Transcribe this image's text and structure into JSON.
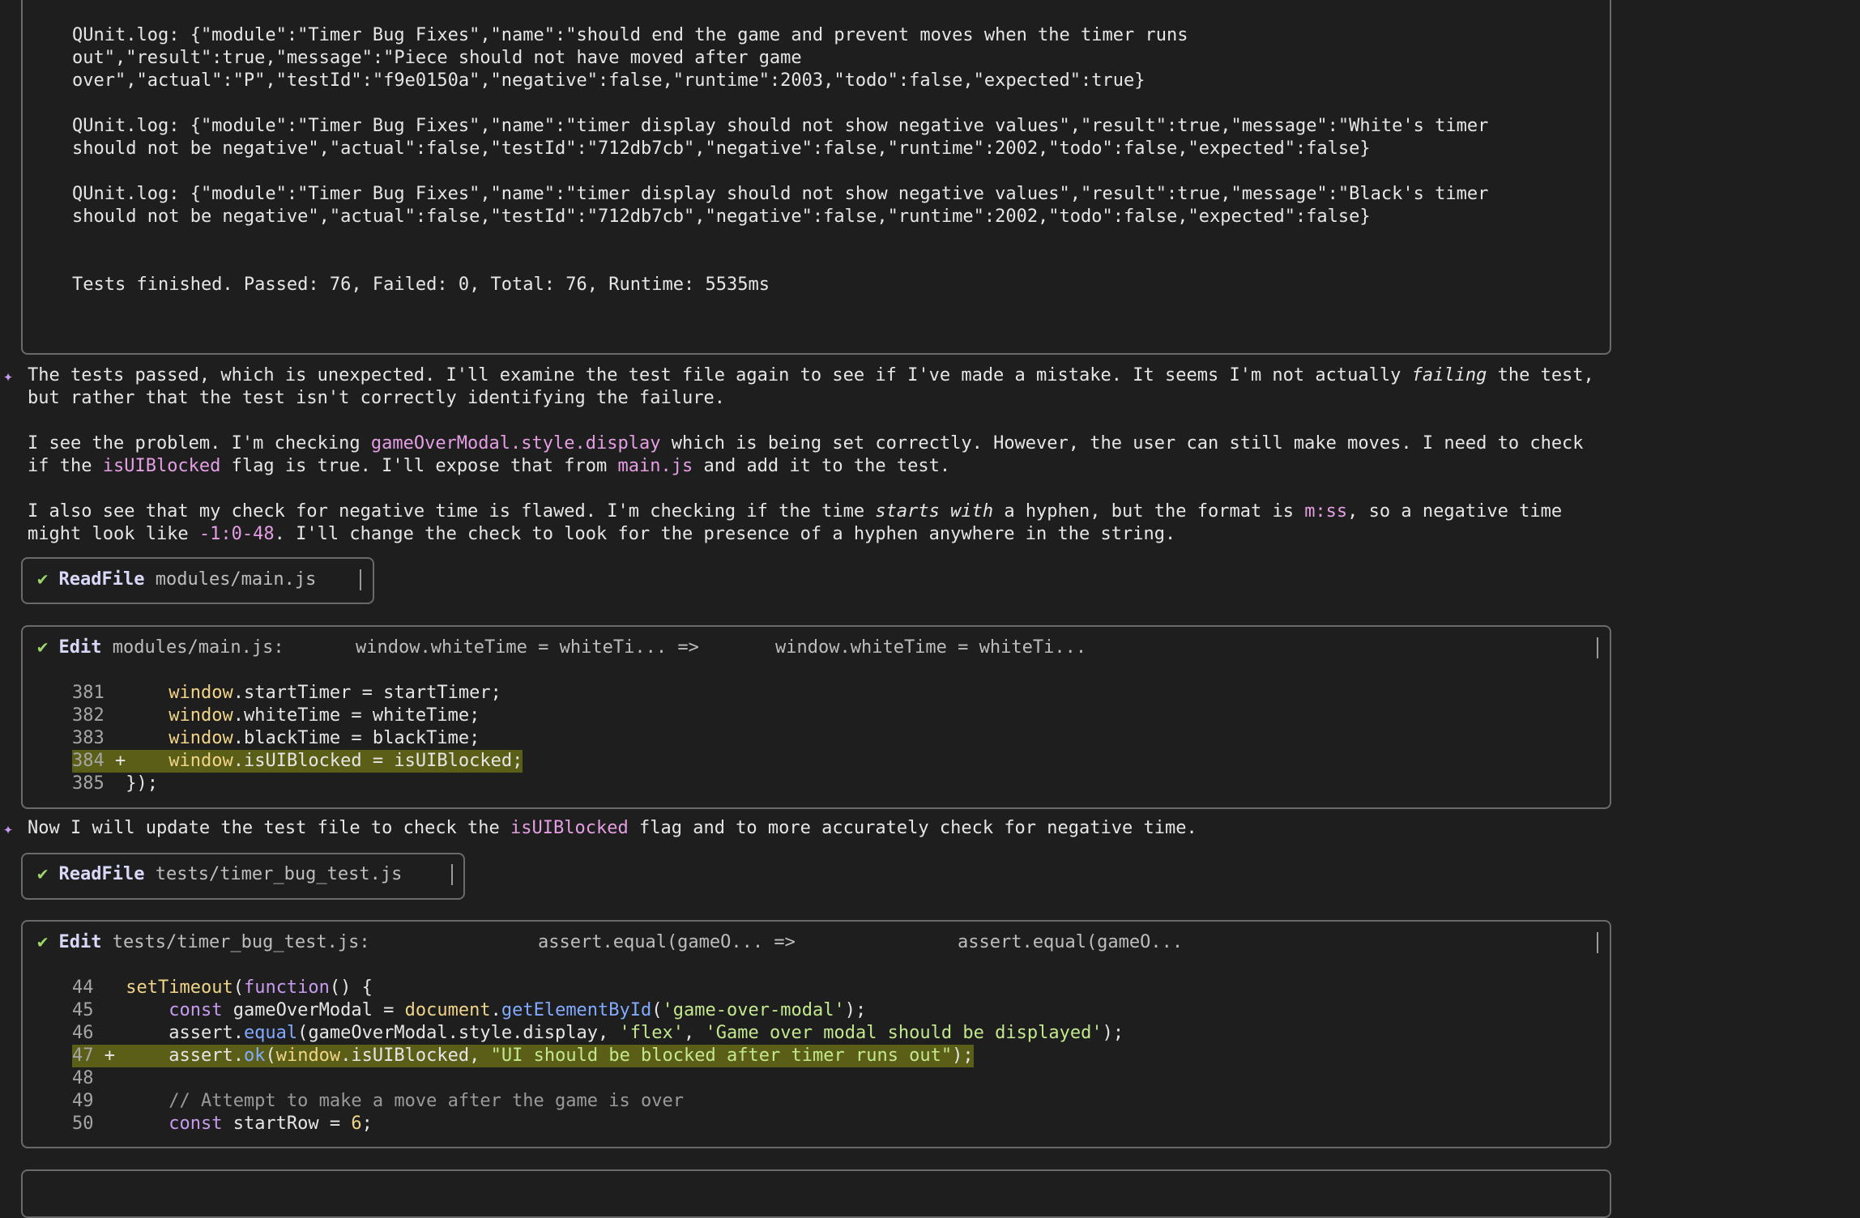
{
  "log_block": {
    "lines": [
      "QUnit.log: {\"module\":\"Timer Bug Fixes\",\"name\":\"should end the game and prevent moves when the timer runs",
      "out\",\"result\":true,\"message\":\"Piece should not have moved after game",
      "over\",\"actual\":\"P\",\"testId\":\"f9e0150a\",\"negative\":false,\"runtime\":2003,\"todo\":false,\"expected\":true}",
      "QUnit.log: {\"module\":\"Timer Bug Fixes\",\"name\":\"timer display should not show negative values\",\"result\":true,\"message\":\"White's timer",
      "should not be negative\",\"actual\":false,\"testId\":\"712db7cb\",\"negative\":false,\"runtime\":2002,\"todo\":false,\"expected\":false}",
      "QUnit.log: {\"module\":\"Timer Bug Fixes\",\"name\":\"timer display should not show negative values\",\"result\":true,\"message\":\"Black's timer",
      "should not be negative\",\"actual\":false,\"testId\":\"712db7cb\",\"negative\":false,\"runtime\":2002,\"todo\":false,\"expected\":false}"
    ],
    "summary": "Tests finished. Passed: 76, Failed: 0, Total: 76, Runtime: 5535ms"
  },
  "msg1": {
    "star": "✦",
    "p1a_pre": "The tests passed, which is unexpected. I'll examine the test file again to see if I've made a mistake. It seems I'm not actually ",
    "p1a_em": "failing",
    "p1a_post": " the test,",
    "p1b": "but rather that the test isn't correctly identifying the failure.",
    "p2a_pre": "I see the problem. I'm checking ",
    "p2a_code": "gameOverModal.style.display",
    "p2a_post": " which is being set correctly. However, the user can still make moves. I need to check",
    "p2b_pre": "if the ",
    "p2b_code1": "isUIBlocked",
    "p2b_mid": " flag is true. I'll expose that from ",
    "p2b_code2": "main.js",
    "p2b_post": " and add it to the test.",
    "p3a_pre": "I also see that my check for negative time is flawed. I'm checking if the time ",
    "p3a_em": "starts with",
    "p3a_mid": " a hyphen, but the format is ",
    "p3a_code": "m:ss",
    "p3a_post": ", so a negative time",
    "p3b_pre": "might look like ",
    "p3b_code": "-1:0-48",
    "p3b_post": ". I'll change the check to look for the presence of a hyphen anywhere in the string."
  },
  "readfile1": {
    "check": "✔",
    "tool": "ReadFile",
    "path": "modules/main.js"
  },
  "edit1": {
    "check": "✔",
    "tool": "Edit",
    "path": "modules/main.js:",
    "from": "window.whiteTime = whiteTi...",
    "arrow": "=>",
    "to": "window.whiteTime = whiteTi...",
    "rows": [
      {
        "n": "381",
        "mark": "",
        "win": "window",
        "rest": ".startTimer = startTimer;"
      },
      {
        "n": "382",
        "mark": "",
        "win": "window",
        "rest": ".whiteTime = whiteTime;"
      },
      {
        "n": "383",
        "mark": "",
        "win": "window",
        "rest": ".blackTime = blackTime;"
      },
      {
        "n": "384",
        "mark": "+",
        "win": "window",
        "rest": ".isUIBlocked = isUIBlocked;"
      },
      {
        "n": "385",
        "mark": "",
        "win": "",
        "rest": "});"
      }
    ]
  },
  "msg2": {
    "star": "✦",
    "pre": "Now I will update the test file to check the ",
    "code": "isUIBlocked",
    "post": " flag and to more accurately check for negative time."
  },
  "readfile2": {
    "check": "✔",
    "tool": "ReadFile",
    "path": "tests/timer_bug_test.js"
  },
  "edit2": {
    "check": "✔",
    "tool": "Edit",
    "path": "tests/timer_bug_test.js:",
    "from": "assert.equal(gameO...",
    "arrow": "=>",
    "to": "assert.equal(gameO...",
    "n44": "44",
    "l44_fn": "setTimeout",
    "l44_p": "(",
    "l44_kw": "function",
    "l44_rest": "() {",
    "n45": "45",
    "l45_kw": "const",
    "l45_a": " gameOverModal = ",
    "l45_doc": "document",
    "l45_dot": ".",
    "l45_fn": "getElementById",
    "l45_p": "(",
    "l45_str": "'game-over-modal'",
    "l45_end": ");",
    "n46": "46",
    "l46_a": "assert.",
    "l46_fn": "equal",
    "l46_b": "(gameOverModal.style.display, ",
    "l46_s1": "'flex'",
    "l46_c": ", ",
    "l46_s2": "'Game over modal should be displayed'",
    "l46_end": ");",
    "n47": "47",
    "m47": "+",
    "l47_a": "assert.",
    "l47_fn": "ok",
    "l47_p": "(",
    "l47_win": "window",
    "l47_b": ".isUIBlocked, ",
    "l47_str": "\"UI should be blocked after timer runs out\"",
    "l47_end": ");",
    "n48": "48",
    "n49": "49",
    "l49_cmt": "// Attempt to make a move after the game is over",
    "n50": "50",
    "l50_kw": "const",
    "l50_a": " startRow = ",
    "l50_num": "6",
    "l50_end": ";"
  }
}
